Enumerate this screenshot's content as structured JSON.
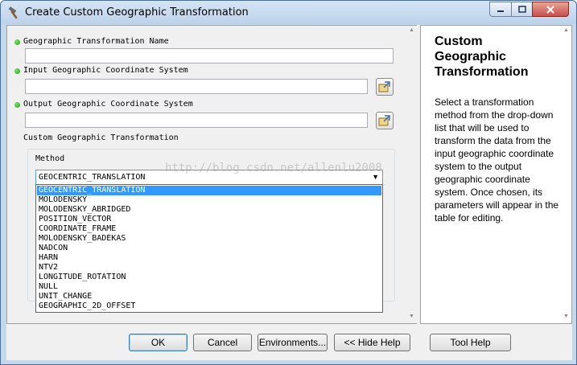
{
  "window": {
    "title": "Create Custom Geographic Transformation",
    "controls": [
      "minimize-icon",
      "maximize-icon",
      "close-icon"
    ]
  },
  "form": {
    "name_label": "Geographic Transformation Name",
    "name_value": "",
    "input_gcs_label": "Input Geographic Coordinate System",
    "input_gcs_value": "",
    "output_gcs_label": "Output Geographic Coordinate System",
    "output_gcs_value": "",
    "custom_group_label": "Custom Geographic Transformation",
    "method_label": "Method",
    "method_value": "GEOCENTRIC_TRANSLATION",
    "method_options": [
      "GEOCENTRIC_TRANSLATION",
      "MOLODENSKY",
      "MOLODENSKY_ABRIDGED",
      "POSITION_VECTOR",
      "COORDINATE_FRAME",
      "MOLODENSKY_BADEKAS",
      "NADCON",
      "HARN",
      "NTV2",
      "LONGITUDE_ROTATION",
      "NULL",
      "UNIT_CHANGE",
      "GEOGRAPHIC_2D_OFFSET"
    ],
    "watermark": "http://blog.csdn.net/allenlu2008"
  },
  "help": {
    "title": "Custom Geographic Transformation",
    "body": "Select a transformation method from the drop-down list that will be used to transform the data from the input geographic coordinate system to the output geographic coordinate system. Once chosen, its parameters will appear in the table for editing."
  },
  "buttons": {
    "ok": "OK",
    "cancel": "Cancel",
    "environments": "Environments...",
    "hide_help": "<< Hide Help",
    "tool_help": "Tool Help"
  },
  "colors": {
    "selection": "#3399ff",
    "required_dot": "#15a80b",
    "title_bar": "#c5d7ea"
  }
}
